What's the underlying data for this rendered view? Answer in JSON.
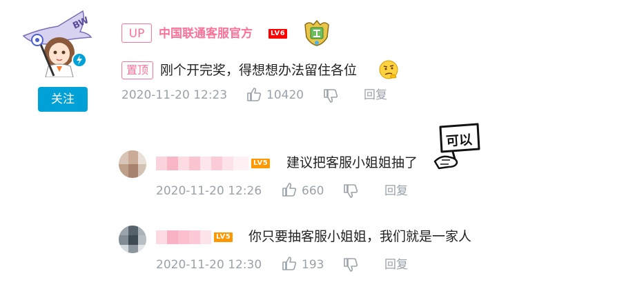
{
  "main_comment": {
    "up_label": "UP",
    "username": "中国联通客服官方",
    "level": "LV6",
    "pin_label": "置顶",
    "content": "刚个开完奖，得想想办法留住各位",
    "time": "2020-11-20 12:23",
    "likes": "10420",
    "reply_label": "回复",
    "follow_label": "关注",
    "avatar_text": "BW"
  },
  "replies": [
    {
      "level": "LV5",
      "content": "建议把客服小姐姐抽了",
      "time": "2020-11-20 12:26",
      "likes": "660",
      "reply_label": "回复",
      "sticker_text": "可以"
    },
    {
      "level": "LV5",
      "content": "你只要抽客服小姐姐，我们就是一家人",
      "time": "2020-11-20 12:30",
      "likes": "193",
      "reply_label": "回复"
    }
  ],
  "colors": {
    "pink": "#fb7299",
    "blue": "#00a1d6",
    "gray": "#99a2aa",
    "lv6": "#ff0000",
    "lv5": "#ff9800"
  }
}
